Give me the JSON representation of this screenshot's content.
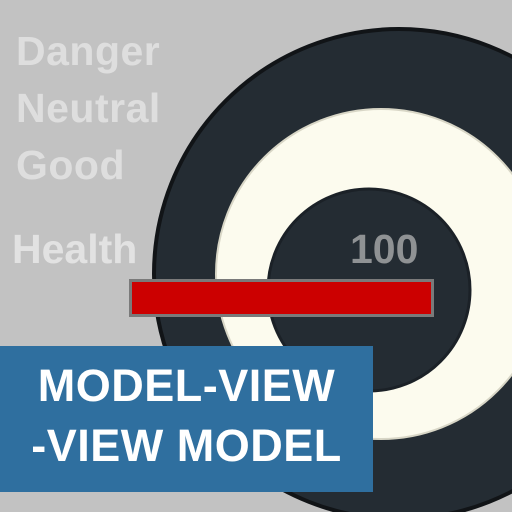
{
  "mood_states": [
    "Danger",
    "Neutral",
    "Good"
  ],
  "health": {
    "label": "Health",
    "value": "100",
    "bar_fill_fraction": 1.0,
    "bar_color": "#cc0000"
  },
  "banner": {
    "line1": "MODEL-VIEW",
    "line2": "-VIEW MODEL",
    "background": "#2f6f9f"
  },
  "colors": {
    "background": "#c2c2c2",
    "target_dark": "#242c33",
    "target_light": "#fcfbee"
  },
  "icons": [
    "target-icon"
  ]
}
